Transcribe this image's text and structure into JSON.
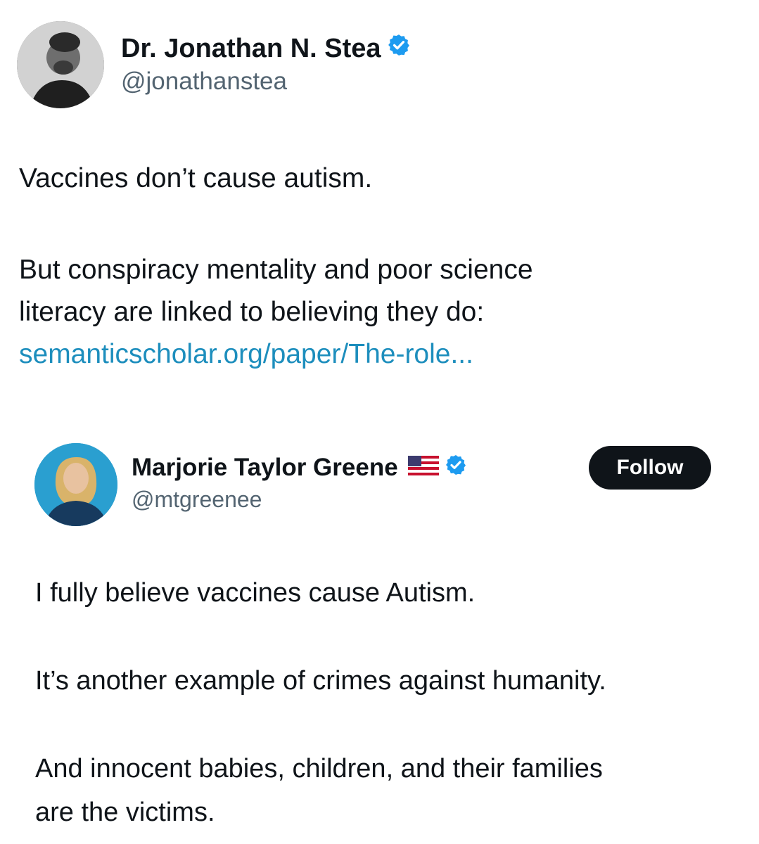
{
  "outer_tweet": {
    "author_name": "Dr. Jonathan N. Stea",
    "handle": "@jonathanstea",
    "verified": true,
    "text": {
      "line1": "Vaccines don’t cause autism.",
      "line2": "But conspiracy mentality and poor science",
      "line3": "literacy are linked to believing they do:",
      "link": "semanticscholar.org/paper/The-role..."
    }
  },
  "quoted_tweet": {
    "author_name": "Marjorie Taylor Greene",
    "handle": "@mtgreenee",
    "verified": true,
    "flag_icon": "us-flag-icon",
    "follow_label": "Follow",
    "text": {
      "p1": "I fully believe vaccines cause Autism.",
      "p2": "It’s another example of crimes against humanity.",
      "p3_line1": "And innocent babies, children, and their families",
      "p3_line2": "are the victims."
    }
  },
  "colors": {
    "verified_badge": "#1d9bf0",
    "link": "#1d8ebd",
    "handle": "#536471",
    "button_bg": "#0f1419"
  }
}
